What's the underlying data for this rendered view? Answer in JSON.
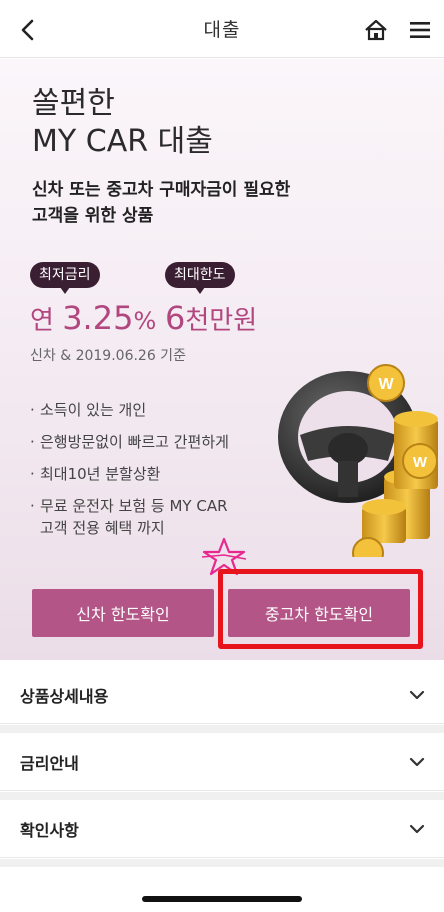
{
  "header": {
    "title": "대출",
    "back_icon": "chevron-left-icon",
    "home_icon": "home-icon",
    "menu_icon": "hamburger-icon"
  },
  "hero": {
    "title_lines": [
      "쏠편한",
      "MY CAR 대출"
    ],
    "subtitle_lines": [
      "신차 또는 중고차 구매자금이 필요한",
      "고객을 위한 상품"
    ],
    "rate_tag": "최저금리",
    "rate_prefix": "연 ",
    "rate_value": "3.25",
    "rate_unit": "%",
    "limit_tag": "최대한도",
    "limit_value": "6",
    "limit_rest": "천만원",
    "basis": "신차 & 2019.06.26 기준",
    "bullets": [
      {
        "lines": [
          "소득이 있는 개인"
        ]
      },
      {
        "lines": [
          "은행방문없이 빠르고 간편하게"
        ]
      },
      {
        "lines": [
          "최대10년 분할상환"
        ]
      },
      {
        "lines": [
          "무료 운전자 보험 등 MY CAR",
          "고객 전용 혜택 까지"
        ]
      }
    ],
    "coin_symbol": "W"
  },
  "buttons": {
    "new_car": "신차 한도확인",
    "used_car": "중고차 한도확인"
  },
  "accordion": [
    {
      "label": "상품상세내용"
    },
    {
      "label": "금리안내"
    },
    {
      "label": "확인사항"
    }
  ],
  "colors": {
    "accent": "#b35586",
    "rate_text": "#b2477f",
    "tag_bg": "#3a1f33",
    "highlight": "#e8141b",
    "star": "#e8278f"
  }
}
